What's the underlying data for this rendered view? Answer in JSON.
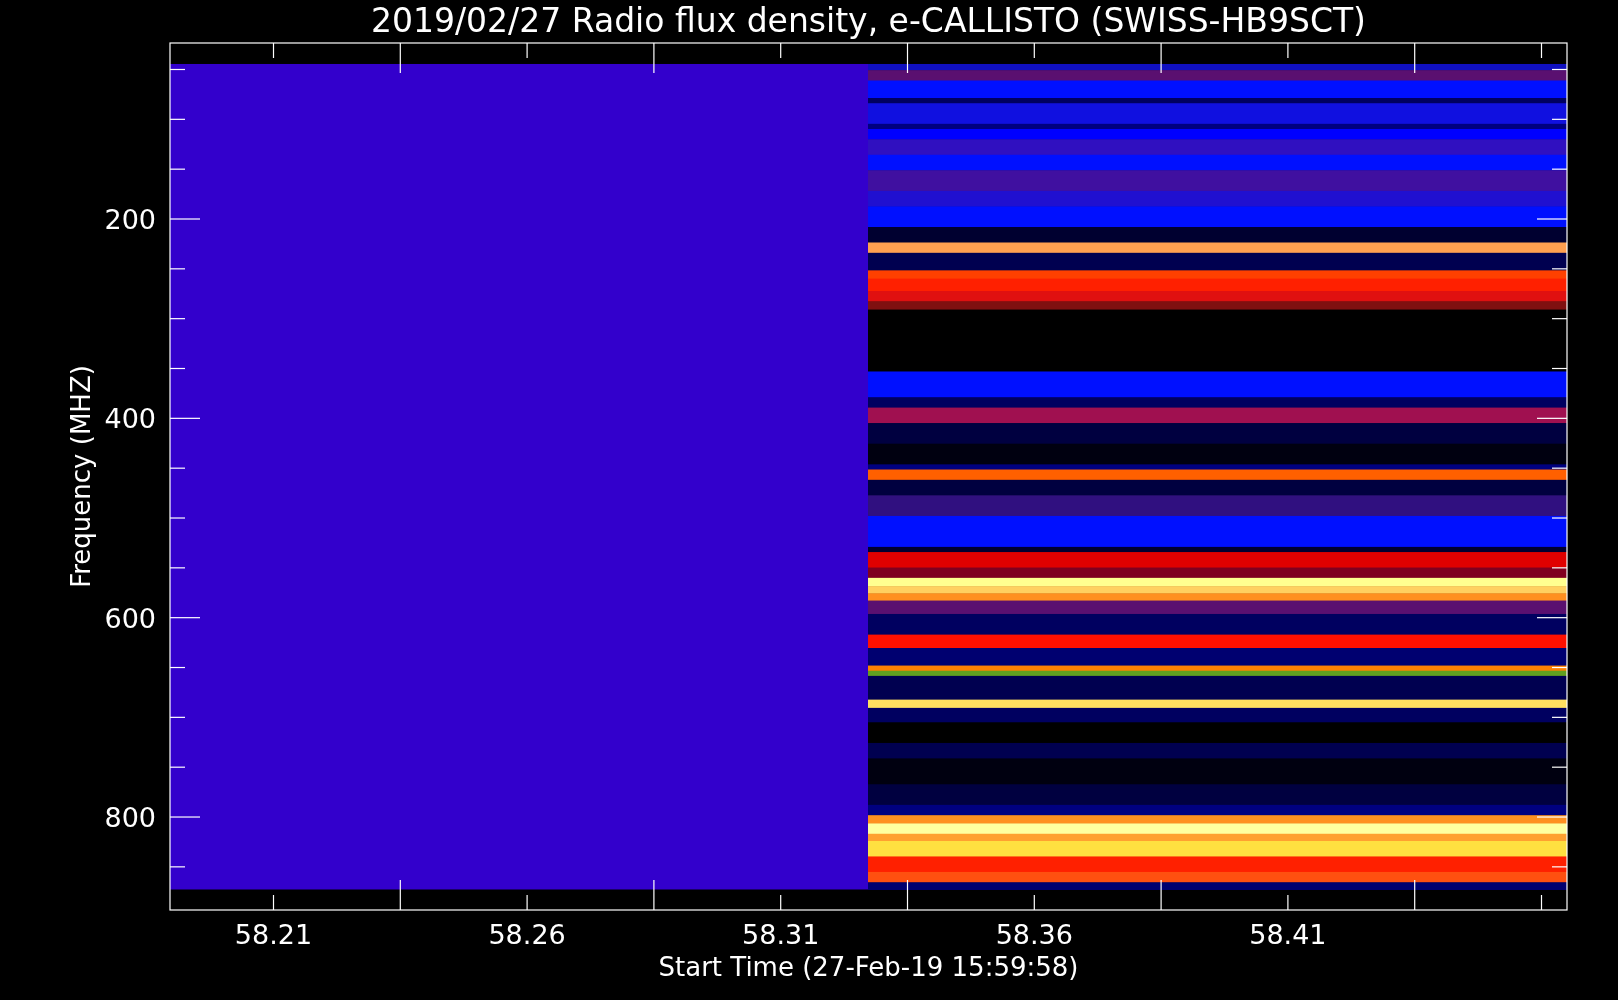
{
  "chart": {
    "title": "2019/02/27  Radio flux density, e-CALLISTO (SWISS-HB9SCT)",
    "y_axis": {
      "label": "Frequency (MHZ)",
      "ticks": [
        "200",
        "400",
        "600",
        "800"
      ]
    },
    "x_axis": {
      "label": "Start Time (27-Feb-19 15:59:58)",
      "ticks": [
        "58.21",
        "58.26",
        "58.31",
        "58.36",
        "58.41"
      ]
    }
  }
}
